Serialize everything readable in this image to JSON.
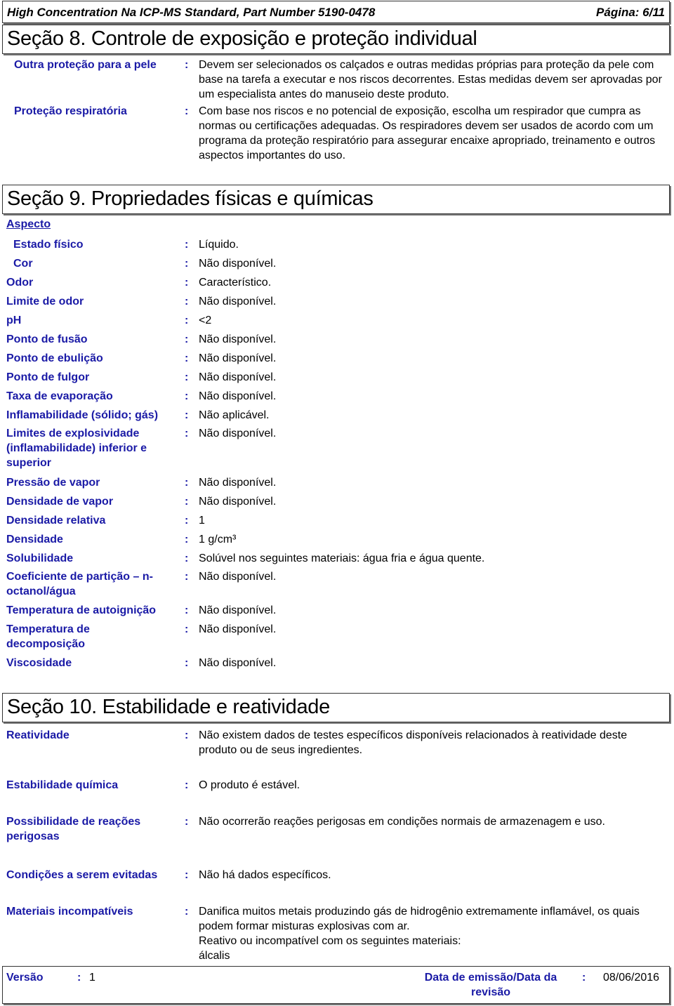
{
  "header": {
    "title": "High Concentration Na ICP-MS Standard, Part Number 5190-0478",
    "page": "Página: 6/11"
  },
  "section8": {
    "title": "Seção 8. Controle de exposição e proteção individual",
    "rows": [
      {
        "label": "Outra proteção para a pele",
        "value": "Devem ser selecionados os calçados e outras medidas próprias para proteção da pele com base na tarefa a executar e nos riscos decorrentes. Estas medidas devem ser aprovadas por um especialista antes do manuseio deste produto."
      },
      {
        "label": "Proteção respiratória",
        "value": "Com base nos riscos e no potencial de exposição, escolha um respirador que cumpra as normas ou certificações adequadas.  Os respiradores devem ser usados de acordo com um programa da proteção respiratório para assegurar encaixe apropriado, treinamento e outros aspectos importantes do uso."
      }
    ]
  },
  "section9": {
    "title": "Seção 9. Propriedades físicas e químicas",
    "subheading": "Aspecto",
    "rows": [
      {
        "label": "Estado físico",
        "value": "Líquido."
      },
      {
        "label": "Cor",
        "value": "Não disponível."
      },
      {
        "label": "Odor",
        "value": "Característico."
      },
      {
        "label": "Limite de odor",
        "value": "Não disponível."
      },
      {
        "label": "pH",
        "value": "<2"
      },
      {
        "label": "Ponto de fusão",
        "value": "Não disponível."
      },
      {
        "label": "Ponto de ebulição",
        "value": "Não disponível."
      },
      {
        "label": "Ponto de fulgor",
        "value": "Não disponível."
      },
      {
        "label": "Taxa de evaporação",
        "value": "Não disponível."
      },
      {
        "label": "Inflamabilidade (sólido; gás)",
        "value": "Não aplicável."
      },
      {
        "label": "Limites de explosividade (inflamabilidade) inferior e superior",
        "value": "Não disponível."
      },
      {
        "label": "Pressão de vapor",
        "value": "Não disponível."
      },
      {
        "label": "Densidade de vapor",
        "value": "Não disponível."
      },
      {
        "label": "Densidade relativa",
        "value": "1"
      },
      {
        "label": "Densidade",
        "value": "1 g/cm³"
      },
      {
        "label": "Solubilidade",
        "value": "Solúvel nos seguintes materiais: água fria e água quente."
      },
      {
        "label": "Coeficiente de partição – n-octanol/água",
        "value": "Não disponível."
      },
      {
        "label": "Temperatura de autoignição",
        "value": "Não disponível."
      },
      {
        "label": "Temperatura de decomposição",
        "value": "Não disponível."
      },
      {
        "label": "Viscosidade",
        "value": "Não disponível."
      }
    ]
  },
  "section10": {
    "title": "Seção 10. Estabilidade e reatividade",
    "rows": [
      {
        "label": "Reatividade",
        "value": "Não existem dados de testes específicos disponíveis relacionados à reatividade deste produto ou de seus ingredientes."
      },
      {
        "label": "Estabilidade química",
        "value": "O produto é estável."
      },
      {
        "label": "Possibilidade de reações perigosas",
        "value": "Não ocorrerão reações perigosas em condições normais de armazenagem e uso."
      },
      {
        "label": "Condições a serem evitadas",
        "value": "Não há dados específicos."
      },
      {
        "label": "Materiais incompatíveis",
        "value": "Danifica muitos metais produzindo gás de hidrogênio extremamente inflamável, os quais podem formar misturas explosivas com ar.",
        "value2": "Reativo ou incompatível com os seguintes materiais:",
        "value3": "álcalis"
      }
    ]
  },
  "footer": {
    "version_label": "Versão",
    "version_value": "1",
    "date_label": "Data de emissão/Data da revisão",
    "date_value": "08/06/2016"
  },
  "colon": ":"
}
